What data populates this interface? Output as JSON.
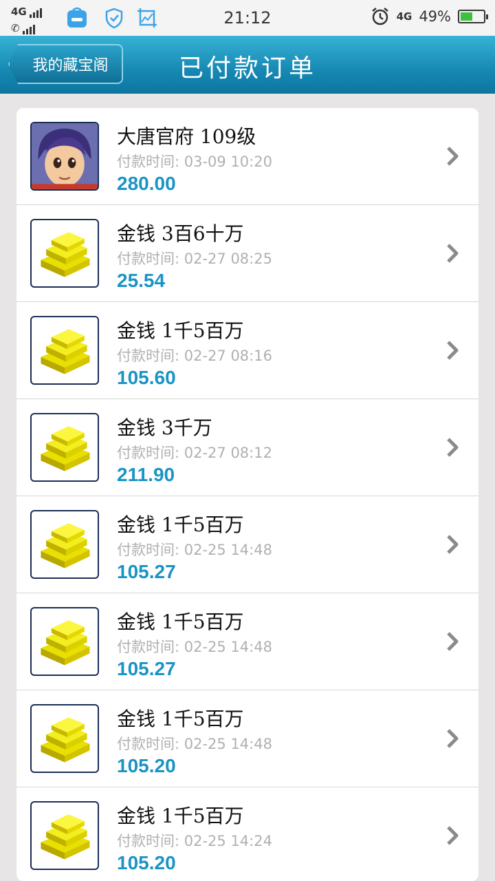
{
  "status_bar": {
    "network_top": "4G",
    "time": "21:12",
    "network_right": "4G",
    "battery": "49%"
  },
  "header": {
    "back_label": "我的藏宝阁",
    "title": "已付款订单"
  },
  "orders": [
    {
      "title": "大唐官府  109级",
      "time": "付款时间: 03-09 10:20",
      "amount": "280.00",
      "icon": "character-avatar-icon"
    },
    {
      "title": "金钱  3百6十万",
      "time": "付款时间: 02-27 08:25",
      "amount": "25.54",
      "icon": "gold-bars-icon"
    },
    {
      "title": "金钱  1千5百万",
      "time": "付款时间: 02-27 08:16",
      "amount": "105.60",
      "icon": "gold-bars-icon"
    },
    {
      "title": "金钱  3千万",
      "time": "付款时间: 02-27 08:12",
      "amount": "211.90",
      "icon": "gold-bars-icon"
    },
    {
      "title": "金钱  1千5百万",
      "time": "付款时间: 02-25 14:48",
      "amount": "105.27",
      "icon": "gold-bars-icon"
    },
    {
      "title": "金钱  1千5百万",
      "time": "付款时间: 02-25 14:48",
      "amount": "105.27",
      "icon": "gold-bars-icon"
    },
    {
      "title": "金钱  1千5百万",
      "time": "付款时间: 02-25 14:48",
      "amount": "105.20",
      "icon": "gold-bars-icon"
    },
    {
      "title": "金钱  1千5百万",
      "time": "付款时间: 02-25 14:24",
      "amount": "105.20",
      "icon": "gold-bars-icon"
    }
  ],
  "colors": {
    "header": "#1689b3",
    "amount": "#1a94c4",
    "time": "#b0b0b0"
  }
}
